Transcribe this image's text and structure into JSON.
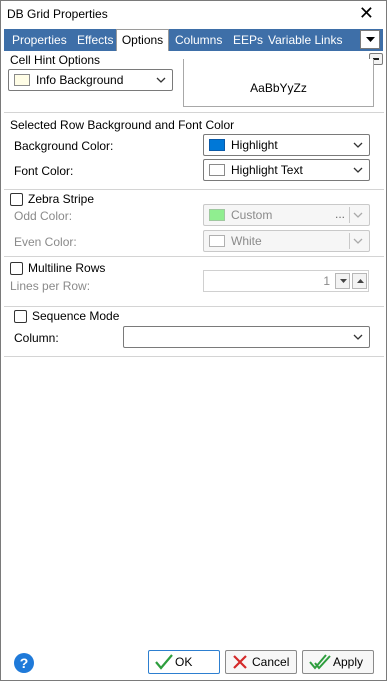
{
  "window": {
    "title": "DB Grid Properties",
    "close_glyph": "✕"
  },
  "tabs": [
    {
      "label": "Properties",
      "active": false
    },
    {
      "label": "Effects",
      "active": false
    },
    {
      "label": "Options",
      "active": true
    },
    {
      "label": "Columns",
      "active": false
    },
    {
      "label": "EEPs",
      "active": false
    },
    {
      "label": "Variable Links",
      "active": false
    }
  ],
  "cell_hint": {
    "legend": "Cell Hint Options",
    "color_value": "Info Background",
    "color_swatch": "#fffde6",
    "preview_text": "AaBbYyZz"
  },
  "selected_row": {
    "legend": "Selected Row Background and Font Color",
    "background_label": "Background Color:",
    "background_value": "Highlight",
    "background_swatch": "#0078d7",
    "font_label": "Font Color:",
    "font_value": "Highlight Text",
    "font_swatch": "#ffffff"
  },
  "zebra": {
    "checkbox_label": "Zebra Stripe",
    "checked": false,
    "odd_label": "Odd Color:",
    "odd_value": "Custom",
    "odd_ellipsis": "...",
    "odd_swatch": "#90ee90",
    "even_label": "Even Color:",
    "even_value": "White",
    "even_swatch": "#ffffff"
  },
  "multiline": {
    "checkbox_label": "Multiline Rows",
    "checked": false,
    "lines_label": "Lines per Row:",
    "lines_value": "1"
  },
  "sequence": {
    "checkbox_label": "Sequence Mode",
    "checked": false,
    "column_label": "Column:",
    "column_value": ""
  },
  "footer": {
    "help_glyph": "?",
    "ok_label": "OK",
    "cancel_label": "Cancel",
    "apply_label": "Apply"
  },
  "colors": {
    "tab_bar": "#3e6fa8",
    "ok_check": "#2e9e3e",
    "cancel_x": "#d42a2a"
  }
}
